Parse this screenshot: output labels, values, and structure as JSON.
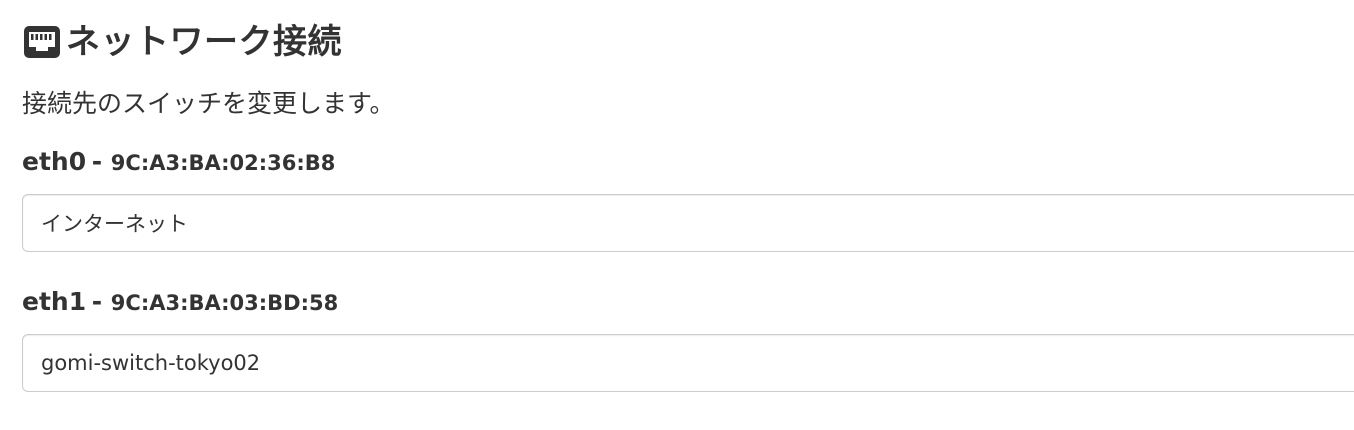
{
  "header": {
    "icon": "ethernet-port-icon",
    "title": "ネットワーク接続"
  },
  "description": "接続先のスイッチを変更します。",
  "interfaces": [
    {
      "name": "eth0",
      "separator": "-",
      "mac": "9C:A3:BA:02:36:B8",
      "value": "インターネット"
    },
    {
      "name": "eth1",
      "separator": "-",
      "mac": "9C:A3:BA:03:BD:58",
      "value": "gomi-switch-tokyo02"
    }
  ],
  "colors": {
    "text": "#333333",
    "border": "#cccccc",
    "background": "#ffffff"
  }
}
